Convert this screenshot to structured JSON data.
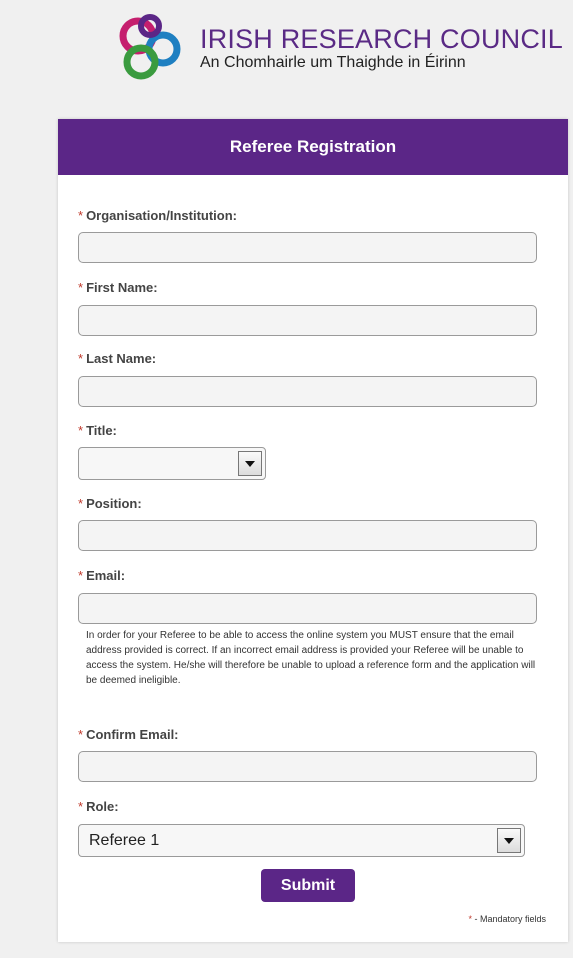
{
  "logo": {
    "title": "IRISH RESEARCH COUNCIL",
    "subtitle": "An Chomhairle um Thaighde in Éirinn",
    "icon": "irc-logo-icon"
  },
  "form": {
    "title": "Referee Registration",
    "required_marker": "*",
    "fields": {
      "organisation": {
        "label": "Organisation/Institution:",
        "value": ""
      },
      "first_name": {
        "label": "First Name:",
        "value": ""
      },
      "last_name": {
        "label": "Last Name:",
        "value": ""
      },
      "title": {
        "label": "Title:",
        "value": ""
      },
      "position": {
        "label": "Position:",
        "value": ""
      },
      "email": {
        "label": "Email:",
        "value": ""
      },
      "confirm_email": {
        "label": "Confirm Email:",
        "value": ""
      },
      "role": {
        "label": "Role:",
        "value": "Referee 1"
      }
    },
    "email_note": "In order for your Referee to be able to access the online system you MUST ensure that the email address provided is correct. If an incorrect email address is provided your Referee will be unable to access the system. He/she will therefore be unable to upload a reference form and the application will be deemed ineligible.",
    "submit_label": "Submit",
    "mandatory_note": "- Mandatory fields"
  },
  "colors": {
    "accent": "#5b2687",
    "required": "#c0392b",
    "page_background": "#f0f0f0"
  }
}
